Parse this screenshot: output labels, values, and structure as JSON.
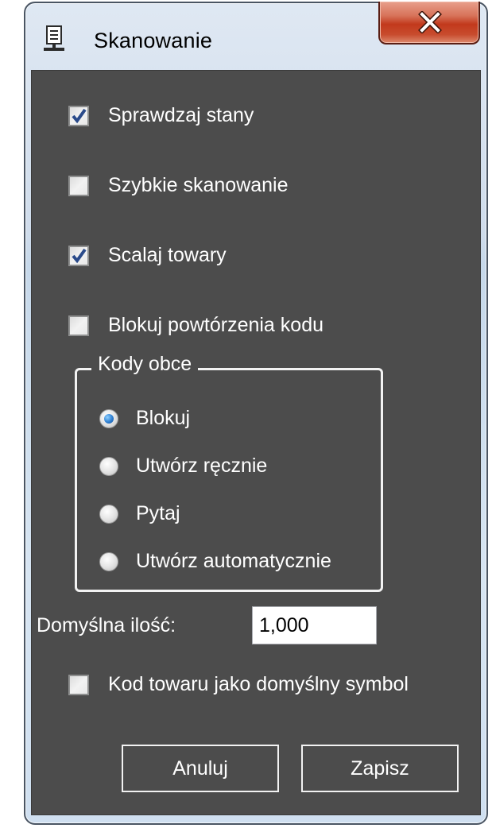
{
  "window": {
    "title": "Skanowanie",
    "icon": "document-stand-icon"
  },
  "titlebar": {
    "close_icon": "close-icon"
  },
  "options": {
    "check_stock": {
      "label": "Sprawdzaj stany",
      "checked": true
    },
    "fast_scan": {
      "label": "Szybkie skanowanie",
      "checked": false
    },
    "merge_goods": {
      "label": "Scalaj towary",
      "checked": true
    },
    "block_repeats": {
      "label": "Blokuj powtórzenia kodu",
      "checked": false
    },
    "code_as_symbol": {
      "label": "Kod towaru jako domyślny symbol",
      "checked": false
    }
  },
  "foreign_codes": {
    "legend": "Kody obce",
    "options": [
      {
        "label": "Blokuj",
        "selected": true
      },
      {
        "label": "Utwórz ręcznie",
        "selected": false
      },
      {
        "label": "Pytaj",
        "selected": false
      },
      {
        "label": "Utwórz automatycznie",
        "selected": false
      }
    ]
  },
  "default_qty": {
    "label": "Domyślna ilość:",
    "value": "1,000"
  },
  "buttons": {
    "cancel": "Anuluj",
    "save": "Zapisz"
  },
  "colors": {
    "client_bg": "#4c4c4c",
    "close_button": "#c2391c",
    "radio_selected": "#2f7fd1",
    "checkmark": "#2a4a8a"
  }
}
